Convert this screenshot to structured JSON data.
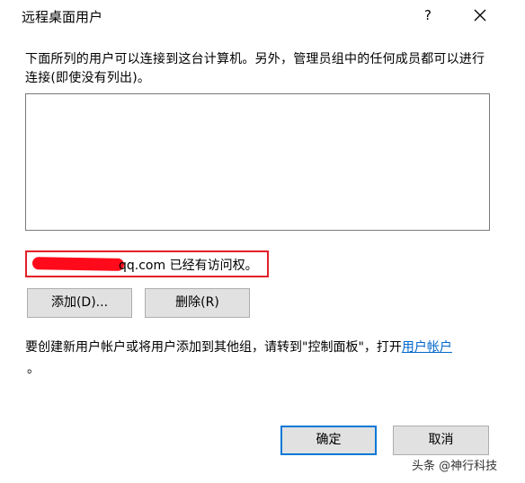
{
  "window": {
    "title": "远程桌面用户",
    "help_label": "?"
  },
  "description": "下面所列的用户可以连接到这台计算机。另外，管理员组中的任何成员都可以进行连接(即使没有列出)。",
  "access_notice": "qq.com 已经有访问权。",
  "buttons": {
    "add": "添加(D)...",
    "delete": "删除(R)",
    "ok": "确定",
    "cancel": "取消"
  },
  "footer": {
    "text": "要创建新用户帐户或将用户添加到其他组，请转到\"控制面板\"，打开",
    "link": "用户帐户",
    "period": "。"
  },
  "watermark": "头条 @神行科技",
  "colors": {
    "highlight_border": "#e2202a",
    "link": "#0066cc",
    "default_button_border": "#0078d7"
  }
}
